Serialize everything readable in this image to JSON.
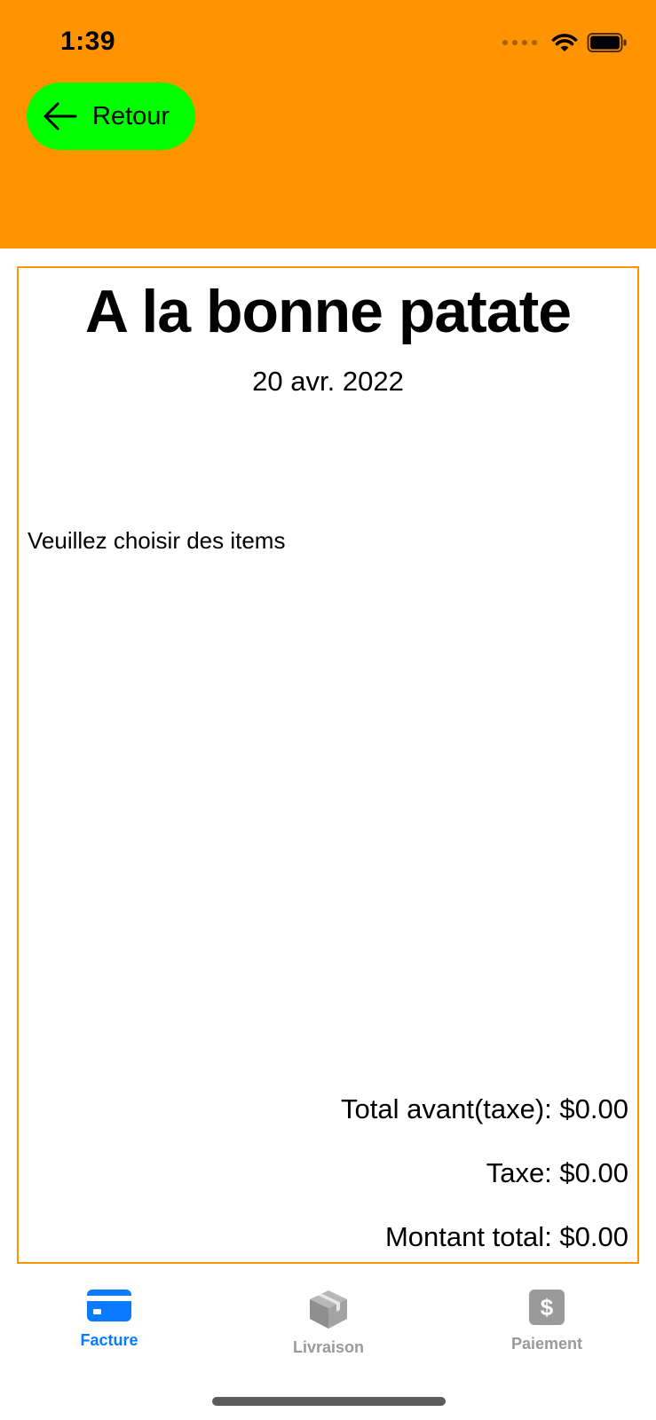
{
  "status_bar": {
    "time": "1:39"
  },
  "header": {
    "background": "#ff9300",
    "back_button": {
      "label": "Retour",
      "icon": "arrow-left-icon",
      "color": "#00ff00"
    }
  },
  "invoice": {
    "store_name": "A la bonne patate",
    "date": "20 avr. 2022",
    "empty_message": "Veuillez choisir des items",
    "subtotal": "Total avant(taxe): $0.00",
    "tax": "Taxe: $0.00",
    "total": "Montant total: $0.00",
    "border_color": "#ff9300"
  },
  "tabbar": {
    "active_color": "#0a7aff",
    "inactive_color": "#9a9a9a",
    "tabs": [
      {
        "label": "Facture",
        "icon": "credit-card-icon",
        "active": true
      },
      {
        "label": "Livraison",
        "icon": "package-box-icon",
        "active": false
      },
      {
        "label": "Paiement",
        "icon": "dollar-sign-icon",
        "active": false
      }
    ]
  }
}
